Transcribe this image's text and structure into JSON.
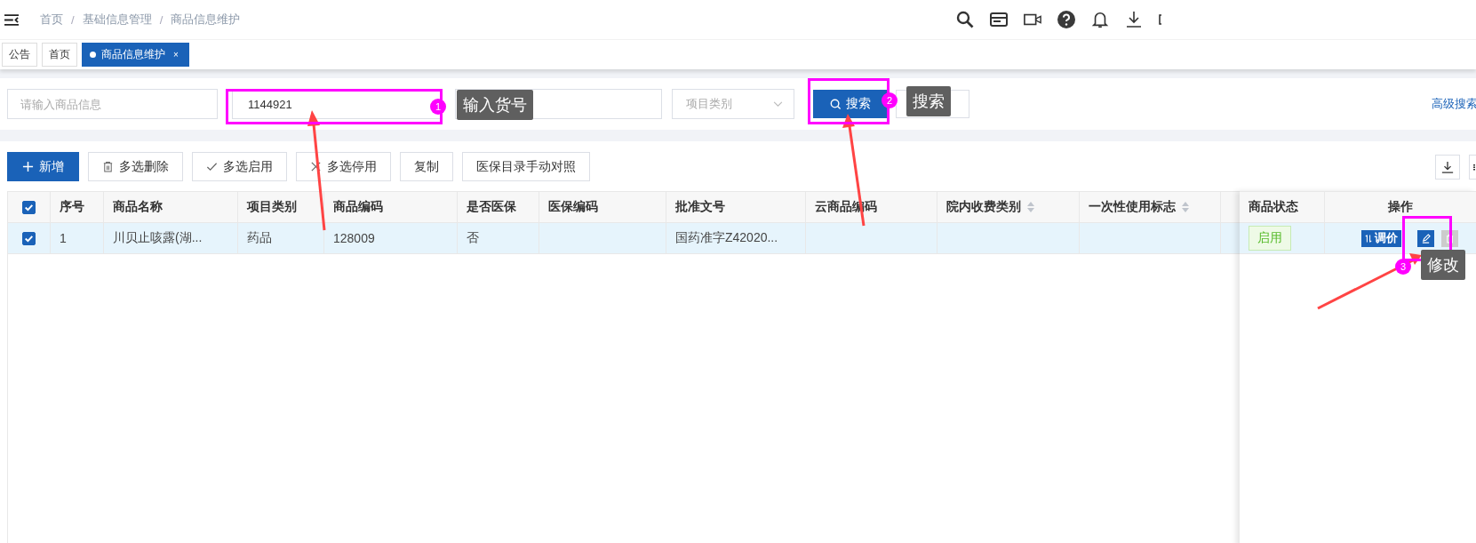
{
  "header": {
    "breadcrumb": [
      "首页",
      "基础信息管理",
      "商品信息维护"
    ],
    "separator": "/"
  },
  "tabs": [
    {
      "label": "公告",
      "selected": false,
      "closable": false
    },
    {
      "label": "首页",
      "selected": false,
      "closable": false
    },
    {
      "label": "商品信息维护",
      "selected": true,
      "closable": true
    }
  ],
  "tab_close": "×",
  "filters": {
    "name_placeholder": "请输入商品信息",
    "code_value": "1144921",
    "category_placeholder": "项目类别",
    "search_button": "搜索",
    "advanced_link": "高级搜索"
  },
  "toolbar": [
    {
      "label": "新增",
      "kind": "add"
    },
    {
      "label": "多选删除",
      "kind": "delete"
    },
    {
      "label": "多选启用",
      "kind": "enable"
    },
    {
      "label": "多选停用",
      "kind": "disable"
    },
    {
      "label": "复制",
      "kind": "plain"
    },
    {
      "label": "医保目录手动对照",
      "kind": "plain"
    }
  ],
  "table": {
    "all_checked": true,
    "columns": [
      {
        "label": "序号",
        "sortable": false
      },
      {
        "label": "商品名称",
        "sortable": false
      },
      {
        "label": "项目类别",
        "sortable": false
      },
      {
        "label": "商品编码",
        "sortable": false
      },
      {
        "label": "是否医保",
        "sortable": false
      },
      {
        "label": "医保编码",
        "sortable": false
      },
      {
        "label": "批准文号",
        "sortable": false
      },
      {
        "label": "云商品编码",
        "sortable": false
      },
      {
        "label": "院内收费类别",
        "sortable": true
      },
      {
        "label": "一次性使用标志",
        "sortable": true
      }
    ],
    "fixed_columns": [
      "商品状态",
      "操作"
    ],
    "rows": [
      {
        "checked": true,
        "selected": true,
        "cells": [
          "1",
          "川贝止咳露(湖...",
          "药品",
          "128009",
          "否",
          "",
          "国药准字Z42020...",
          "",
          "",
          ""
        ],
        "status": "启用",
        "status_on": true,
        "price_button": "调价",
        "delete_disabled": true
      }
    ]
  },
  "annotations": [
    {
      "number": "1",
      "label": "输入货号"
    },
    {
      "number": "2",
      "label": "搜索"
    },
    {
      "number": "3",
      "label": "修改"
    }
  ]
}
